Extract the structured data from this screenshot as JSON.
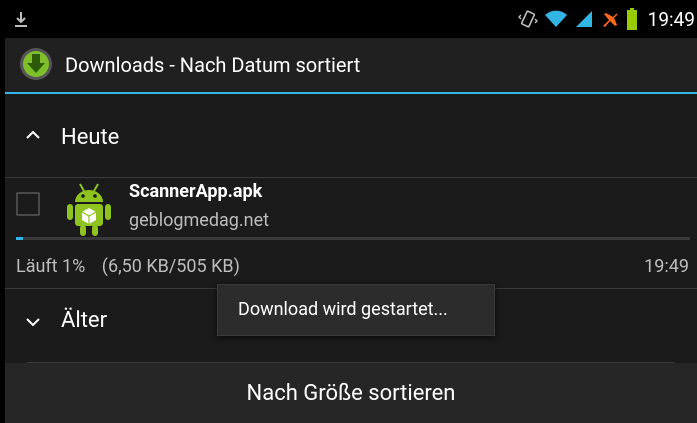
{
  "status_bar": {
    "time": "19:49",
    "icons": [
      "download-icon",
      "vibrate-icon",
      "wifi-icon",
      "signal-icon",
      "airplane-icon",
      "battery-icon"
    ]
  },
  "action_bar": {
    "title": "Downloads - Nach Datum sortiert",
    "accent_color": "#33b5e5"
  },
  "sections": {
    "today": {
      "label": "Heute",
      "expanded": true
    },
    "older": {
      "label": "Älter",
      "expanded": false
    }
  },
  "download_item": {
    "filename": "ScannerApp.apk",
    "source": "geblogmedag.net",
    "status": "Läuft 1%",
    "size": "(6,50 KB/505 KB)",
    "time": "19:49",
    "progress": 0.01
  },
  "toast": {
    "text": "Download wird gestartet..."
  },
  "bottom_button": {
    "label": "Nach Größe sortieren"
  }
}
